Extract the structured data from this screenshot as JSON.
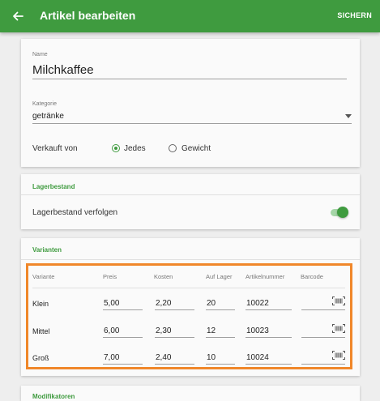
{
  "appbar": {
    "title": "Artikel bearbeiten",
    "save_label": "SICHERN"
  },
  "item": {
    "name_label": "Name",
    "name_value": "Milchkaffee",
    "category_label": "Kategorie",
    "category_value": "getränke",
    "sold_by_label": "Verkauft von",
    "sold_by_options": [
      "Jedes",
      "Gewicht"
    ],
    "sold_by_selected": "Jedes"
  },
  "inventory": {
    "section_title": "Lagerbestand",
    "track_label": "Lagerbestand verfolgen",
    "track_enabled": true
  },
  "variants": {
    "section_title": "Varianten",
    "columns": [
      "Variante",
      "Preis",
      "Kosten",
      "Auf Lager",
      "Artikelnummer",
      "Barcode"
    ],
    "rows": [
      {
        "name": "Klein",
        "price": "5,00",
        "cost": "2,20",
        "stock": "20",
        "sku": "10022"
      },
      {
        "name": "Mittel",
        "price": "6,00",
        "cost": "2,30",
        "stock": "12",
        "sku": "10023"
      },
      {
        "name": "Groß",
        "price": "7,00",
        "cost": "2,40",
        "stock": "10",
        "sku": "10024"
      }
    ]
  },
  "modifiers": {
    "section_title": "Modifikatoren"
  },
  "colors": {
    "primary": "#3f9b3f",
    "highlight": "#f0872a"
  }
}
